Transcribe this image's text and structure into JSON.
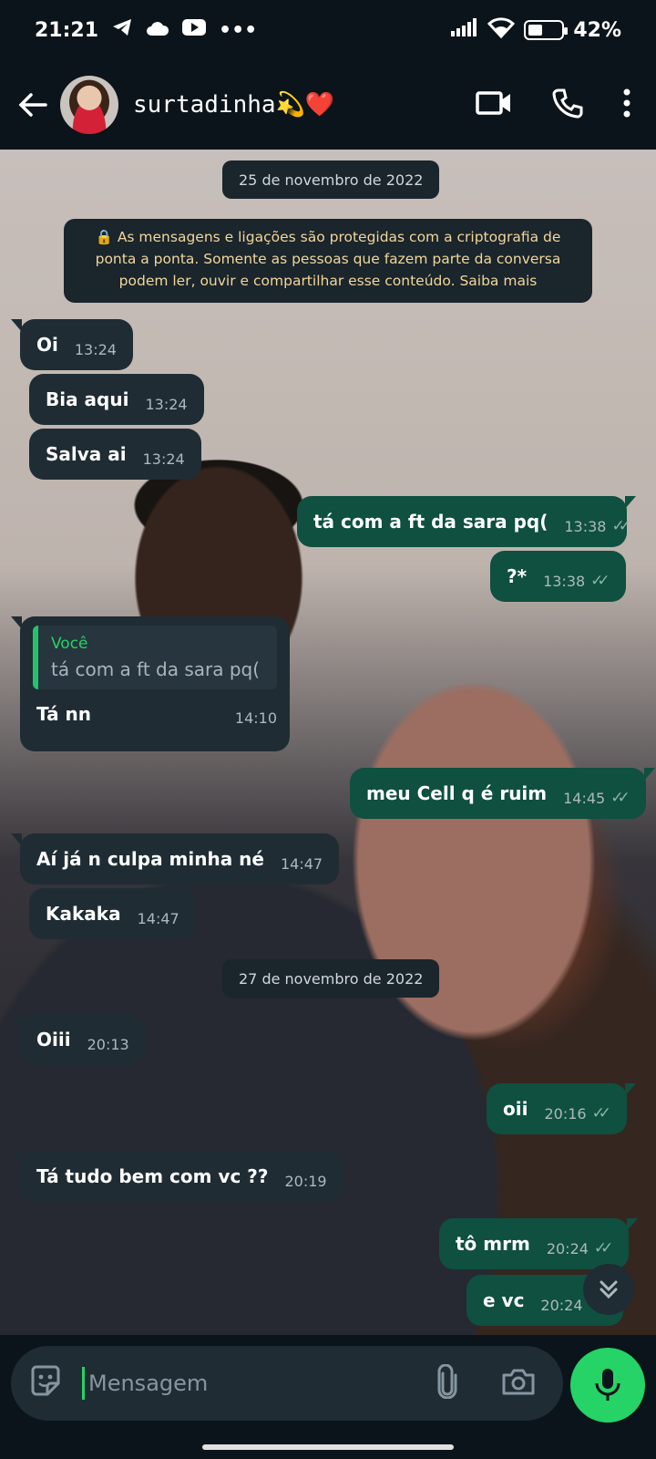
{
  "status_bar": {
    "time": "21:21",
    "dots": "•••",
    "battery_percent": "42%",
    "battery_level": 0.42
  },
  "header": {
    "contact_name": "surtadinha💫❤️"
  },
  "messages_area": {
    "date_1": "25 de novembro de 2022",
    "encryption_notice": "🔒 As mensagens e ligações são protegidas com a criptografia de ponta a ponta. Somente as pessoas que fazem parte da conversa podem ler, ouvir e compartilhar esse conteúdo. Saiba mais",
    "date_2": "27 de novembro de 2022",
    "messages": [
      {
        "dir": "in",
        "text": "Oi",
        "time": "13:24"
      },
      {
        "dir": "in",
        "text": "Bia aqui",
        "time": "13:24"
      },
      {
        "dir": "in",
        "text": "Salva ai",
        "time": "13:24"
      },
      {
        "dir": "out",
        "text": "tá com a ft da sara pq(",
        "time": "13:38"
      },
      {
        "dir": "out",
        "text": "?*",
        "time": "13:38"
      },
      {
        "dir": "in",
        "text": "Tá nn",
        "time": "14:10",
        "reply_author": "Você",
        "reply_text": "tá com a ft da sara pq("
      },
      {
        "dir": "out",
        "text": "meu Cell q é ruim",
        "time": "14:45"
      },
      {
        "dir": "in",
        "text": "Aí já n culpa minha né",
        "time": "14:47"
      },
      {
        "dir": "in",
        "text": "Kakaka",
        "time": "14:47"
      },
      {
        "dir": "in",
        "text": "Oiii",
        "time": "20:13"
      },
      {
        "dir": "out",
        "text": "oii",
        "time": "20:16"
      },
      {
        "dir": "in",
        "text": "Tá tudo bem com vc ??",
        "time": "20:19"
      },
      {
        "dir": "out",
        "text": "tô mrm",
        "time": "20:24"
      },
      {
        "dir": "out",
        "text": "e vc",
        "time": "20:24"
      }
    ]
  },
  "composer": {
    "placeholder": "Mensagem"
  },
  "colors": {
    "accent": "#25d366",
    "outgoing": "#0f5040",
    "incoming": "#1f2c34",
    "background": "#0b141a"
  }
}
